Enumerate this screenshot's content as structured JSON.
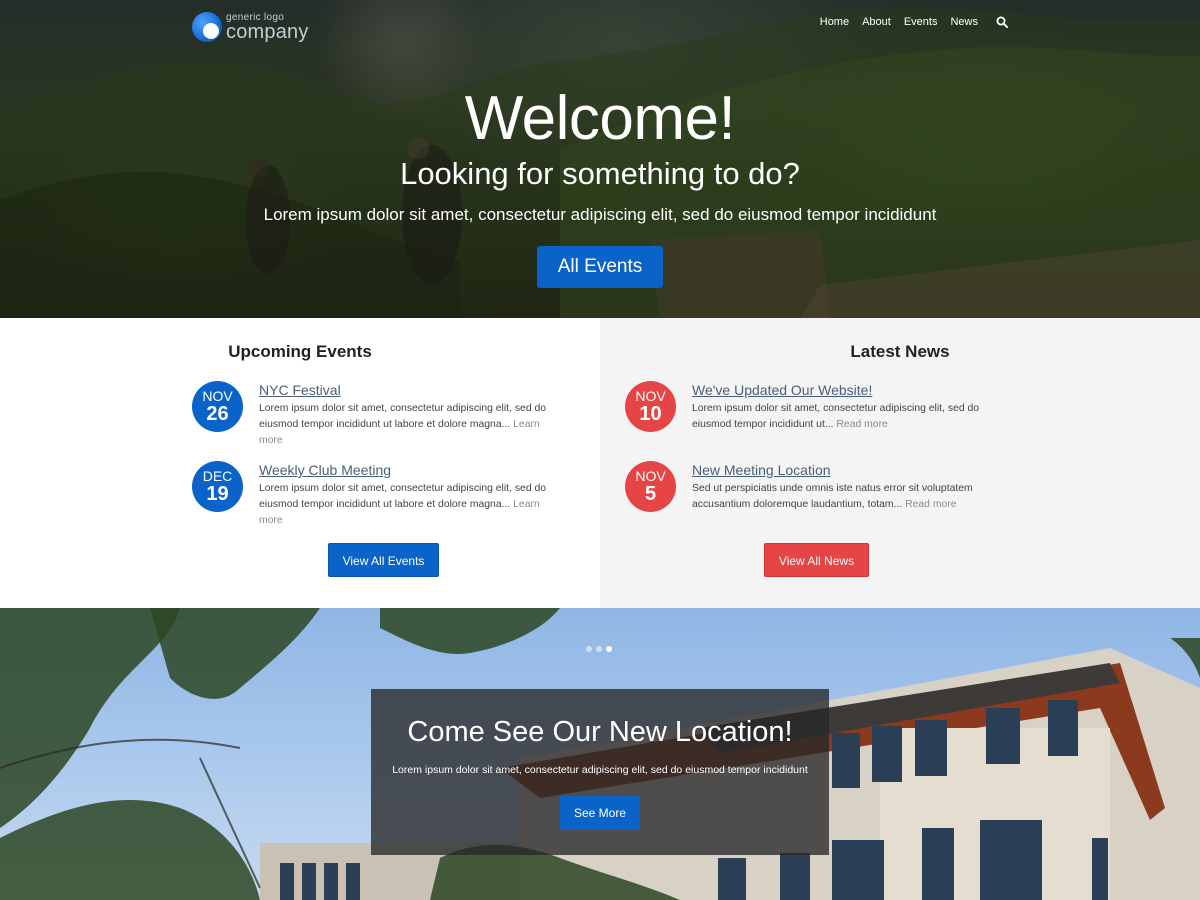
{
  "logo": {
    "small_text": "generic logo",
    "big_text": "company"
  },
  "nav": {
    "items": [
      {
        "label": "Home"
      },
      {
        "label": "About"
      },
      {
        "label": "Events"
      },
      {
        "label": "News"
      }
    ],
    "search_icon": "search-icon"
  },
  "hero": {
    "title": "Welcome!",
    "subtitle": "Looking for something to do?",
    "lead": "Lorem ipsum dolor sit amet, consectetur adipiscing elit, sed do eiusmod tempor incididunt",
    "button_label": "All Events"
  },
  "events": {
    "heading": "Upcoming Events",
    "items": [
      {
        "month": "NOV",
        "day": "26",
        "title": "NYC Festival",
        "text": "Lorem ipsum dolor sit amet, consectetur adipiscing elit, sed do eiusmod tempor incididunt ut labore et dolore magna...",
        "more": "Learn more"
      },
      {
        "month": "DEC",
        "day": "19",
        "title": "Weekly Club Meeting",
        "text": "Lorem ipsum dolor sit amet, consectetur adipiscing elit, sed do eiusmod tempor incididunt ut labore et dolore magna...",
        "more": "Learn more"
      }
    ],
    "button_label": "View All Events"
  },
  "news": {
    "heading": "Latest News",
    "items": [
      {
        "month": "NOV",
        "day": "10",
        "title": "We've Updated Our Website!",
        "text": "Lorem ipsum dolor sit amet, consectetur adipiscing elit, sed do eiusmod tempor incididunt ut...",
        "more": "Read more"
      },
      {
        "month": "NOV",
        "day": "5",
        "title": "New Meeting Location",
        "text": "Sed ut perspiciatis unde omnis iste natus error sit voluptatem accusantium doloremque laudantium, totam...",
        "more": "Read more"
      }
    ],
    "button_label": "View All News"
  },
  "slider": {
    "slide_count": 3,
    "active_slide": 3,
    "title": "Come See Our New Location!",
    "text": "Lorem ipsum dolor sit amet, consectetur adipiscing elit, sed do eiusmod tempor incididunt",
    "button_label": "See More"
  },
  "colors": {
    "primary_blue": "#0a63c9",
    "accent_red": "#e64545",
    "panel_gray": "#f4f4f4",
    "link_slate": "#4a5e7a"
  }
}
